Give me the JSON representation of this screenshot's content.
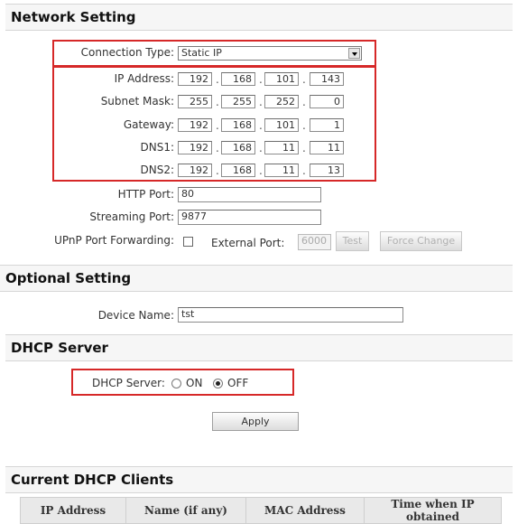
{
  "network": {
    "title": "Network Setting",
    "connection_type_label": "Connection Type:",
    "connection_type_value": "Static IP",
    "ip_label": "IP Address:",
    "ip": [
      "192",
      "168",
      "101",
      "143"
    ],
    "subnet_label": "Subnet Mask:",
    "subnet": [
      "255",
      "255",
      "252",
      "0"
    ],
    "gateway_label": "Gateway:",
    "gateway": [
      "192",
      "168",
      "101",
      "1"
    ],
    "dns1_label": "DNS1:",
    "dns1": [
      "192",
      "168",
      "11",
      "11"
    ],
    "dns2_label": "DNS2:",
    "dns2": [
      "192",
      "168",
      "11",
      "13"
    ],
    "http_port_label": "HTTP Port:",
    "http_port": "80",
    "streaming_port_label": "Streaming Port:",
    "streaming_port": "9877",
    "upnp_label": "UPnP Port Forwarding:",
    "external_port_label": "External Port:",
    "external_port": "6000",
    "test_button": "Test",
    "force_change_button": "Force Change"
  },
  "optional": {
    "title": "Optional Setting",
    "device_name_label": "Device Name:",
    "device_name": "tst"
  },
  "dhcp": {
    "title": "DHCP Server",
    "label": "DHCP Server:",
    "on_label": "ON",
    "off_label": "OFF",
    "selected": "OFF",
    "apply_button": "Apply"
  },
  "clients": {
    "title": "Current DHCP Clients",
    "columns": [
      "IP Address",
      "Name (if any)",
      "MAC Address",
      "Time when IP obtained"
    ]
  },
  "colors": {
    "highlight": "#d62828",
    "section_bg": "#f6f6f6"
  }
}
